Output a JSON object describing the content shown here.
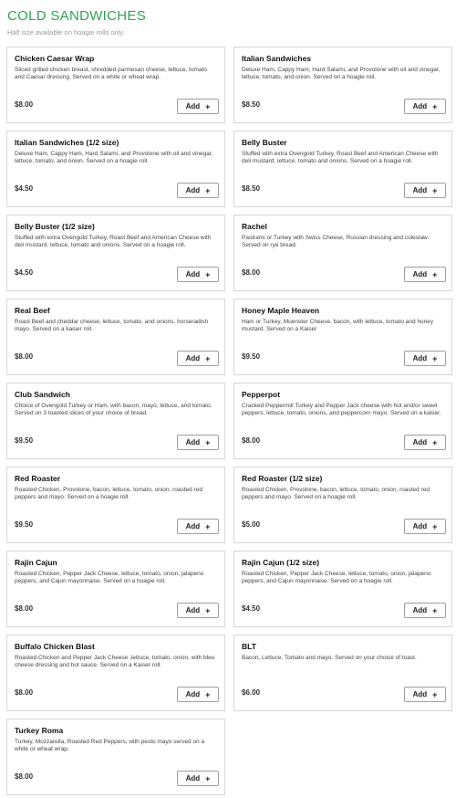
{
  "section": {
    "title": "COLD SANDWICHES",
    "subtitle": "Half size available on hoagie rolls only."
  },
  "icons": {
    "add": "plus-icon"
  },
  "colors": {
    "accent": "#2ea44f"
  },
  "items": [
    {
      "name": "Chicken Caesar Wrap",
      "description": "Sliced grilled chicken breast, shredded parmesan cheese, lettuce, tomato and Caesar dressing. Served on a white or wheat wrap.",
      "price": "$8.00",
      "add_label": "Add",
      "add_symbol": "+"
    },
    {
      "name": "Italian Sandwiches",
      "description": "Deluxe Ham, Cappy Ham, Hard Salami, and Provolone with oil and vinegar, lettuce, tomato, and onion. Served on a hoagie roll.",
      "price": "$8.50",
      "add_label": "Add",
      "add_symbol": "+"
    },
    {
      "name": "Italian Sandwiches (1/2 size)",
      "description": "Deluxe Ham, Cappy Ham, Hard Salami, and Provolone with oil and vinegar, lettuce, tomato, and onion. Served on a hoagie roll.",
      "price": "$4.50",
      "add_label": "Add",
      "add_symbol": "+"
    },
    {
      "name": "Belly Buster",
      "description": "Stuffed with extra Ovengold Turkey, Roast Beef and American Cheese with deli mustard, lettuce, tomato and onions. Served on a hoagie roll.",
      "price": "$8.50",
      "add_label": "Add",
      "add_symbol": "+"
    },
    {
      "name": "Belly Buster (1/2 size)",
      "description": "Stuffed with extra Ovengold Turkey, Roast Beef and American Cheese with deli mustard, lettuce, tomato and onions. Served on a hoagie roll.",
      "price": "$4.50",
      "add_label": "Add",
      "add_symbol": "+"
    },
    {
      "name": "Rachel",
      "description": "Pastrami or Turkey with Swiss Cheese, Russian dressing and coleslaw. Served on rye bread.",
      "price": "$8.00",
      "add_label": "Add",
      "add_symbol": "+"
    },
    {
      "name": "Real Beef",
      "description": "Roast Beef and cheddar cheese, lettuce, tomato, and onions, horseradish mayo. Served on a kaiser roll.",
      "price": "$8.00",
      "add_label": "Add",
      "add_symbol": "+"
    },
    {
      "name": "Honey Maple Heaven",
      "description": "Ham or Turkey, Muenster Cheese, bacon, with lettuce, tomato and honey mustard. Served on a Kaiser",
      "price": "$9.50",
      "add_label": "Add",
      "add_symbol": "+"
    },
    {
      "name": "Club Sandwich",
      "description": "Choice of Ovengold Turkey or Ham, with bacon, mayo, lettuce, and tomato. Served on 3 toasted slices of your choice of bread.",
      "price": "$9.50",
      "add_label": "Add",
      "add_symbol": "+"
    },
    {
      "name": "Pepperpot",
      "description": "Cracked Peppermill Turkey and Pepper Jack cheese with hot and/or sweet peppers, lettuce, tomato, onions, and peppercorn mayo. Served on a kaiser.",
      "price": "$8.00",
      "add_label": "Add",
      "add_symbol": "+"
    },
    {
      "name": "Red Roaster",
      "description": "Roasted Chicken, Provolone, bacon, lettuce, tomato, onion, roasted red peppers and mayo. Served on a hoagie roll.",
      "price": "$9.50",
      "add_label": "Add",
      "add_symbol": "+"
    },
    {
      "name": "Red Roaster (1/2 size)",
      "description": "Roasted Chicken, Provolone, bacon, lettuce, tomato, onion, roasted red peppers and mayo. Served on a hoagie roll.",
      "price": "$5.00",
      "add_label": "Add",
      "add_symbol": "+"
    },
    {
      "name": "Rajin Cajun",
      "description": "Roasted Chicken, Pepper Jack Cheese, lettuce, tomato, onion, jalapeno peppers, and Cajun mayonnaise. Served on a hoagie roll.",
      "price": "$8.00",
      "add_label": "Add",
      "add_symbol": "+"
    },
    {
      "name": "Rajin Cajun (1/2 size)",
      "description": "Roasted Chicken, Pepper Jack Cheese, lettuce, tomato, onion, jalapeno peppers, and Cajun mayonnaise. Served on a hoagie roll.",
      "price": "$4.50",
      "add_label": "Add",
      "add_symbol": "+"
    },
    {
      "name": "Buffalo Chicken Blast",
      "description": "Roasted Chicken and Pepper Jack Cheese ,lettuce, tomato, onion, with bleu cheese dressing and hot sauce. Served on a Kaiser roll.",
      "price": "$8.00",
      "add_label": "Add",
      "add_symbol": "+"
    },
    {
      "name": "BLT",
      "description": "Bacon, Lettuce, Tomato and mayo. Served on your choice of toast.",
      "price": "$6.00",
      "add_label": "Add",
      "add_symbol": "+"
    },
    {
      "name": "Turkey Roma",
      "description": "Turkey, Mozzarella, Roasted Red Peppers, with pesto mayo served on a white or wheat wrap.",
      "price": "$8.00",
      "add_label": "Add",
      "add_symbol": "+"
    }
  ]
}
